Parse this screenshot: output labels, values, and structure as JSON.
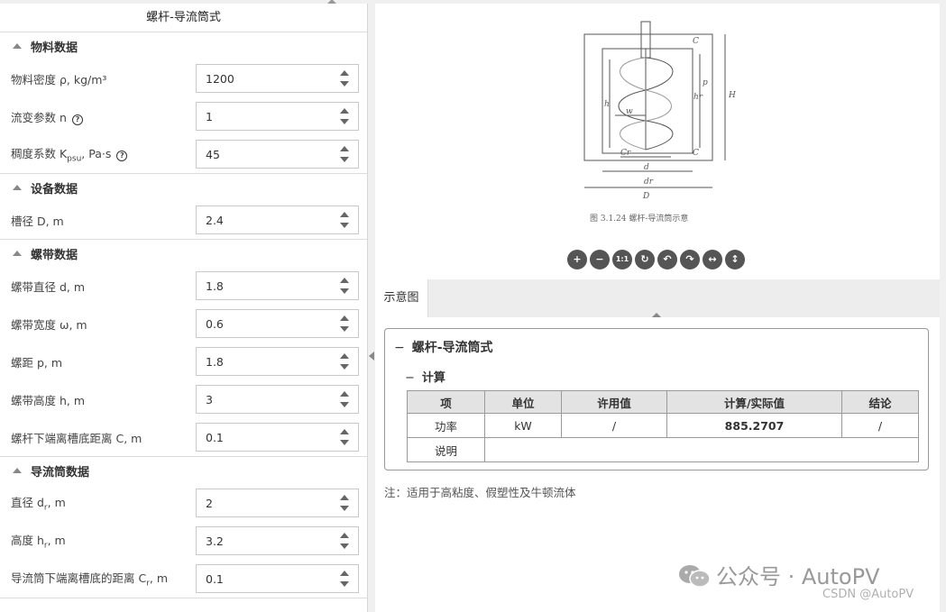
{
  "left": {
    "title": "螺杆-导流筒式",
    "sections": {
      "material": {
        "title": "物料数据",
        "density": {
          "label": "物料密度 ρ, kg/m³",
          "value": "1200"
        },
        "flow_index": {
          "label": "流变参数 n",
          "value": "1"
        },
        "consistency": {
          "label_pre": "稠度系数 K",
          "label_sub": "psu",
          "label_post": ", Pa·s",
          "value": "45"
        }
      },
      "equipment": {
        "title": "设备数据",
        "tank_diameter": {
          "label": "槽径 D, m",
          "value": "2.4"
        }
      },
      "ribbon": {
        "title": "螺带数据",
        "diameter": {
          "label": "螺带直径 d, m",
          "value": "1.8"
        },
        "width": {
          "label": "螺带宽度 ω, m",
          "value": "0.6"
        },
        "pitch": {
          "label": "螺距 p, m",
          "value": "1.8"
        },
        "height": {
          "label": "螺带高度 h, m",
          "value": "3"
        },
        "clearance": {
          "label": "螺杆下端离槽底距离 C, m",
          "value": "0.1"
        }
      },
      "draft_tube": {
        "title": "导流筒数据",
        "diameter": {
          "label_pre": "直径 d",
          "label_sub": "r",
          "label_post": ", m",
          "value": "2"
        },
        "height": {
          "label_pre": "高度 h",
          "label_sub": "r",
          "label_post": ", m",
          "value": "3.2"
        },
        "clearance": {
          "label_pre": "导流筒下端离槽底的距离 C",
          "label_sub": "r",
          "label_post": ", m",
          "value": "0.1"
        }
      }
    }
  },
  "diagram": {
    "caption": "图 3.1.24   螺杆-导流筒示意",
    "labels": {
      "C": "C",
      "p": "p",
      "hr": "hr",
      "H": "H",
      "h": "h",
      "w": "w",
      "Cr": "Cr",
      "d": "d",
      "dr": "dr",
      "D": "D",
      "C2": "C"
    },
    "toolbar": [
      "+",
      "−",
      "1:1",
      "↻",
      "↶",
      "↷",
      "↔",
      "↕"
    ]
  },
  "tabs": [
    {
      "label": "示意图"
    }
  ],
  "results": {
    "title": "螺杆-导流筒式",
    "subtitle": "计算",
    "headers": [
      "项",
      "单位",
      "许用值",
      "计算/实际值",
      "结论"
    ],
    "rows": [
      {
        "item": "功率",
        "unit": "kW",
        "allowed": "/",
        "actual": "885.2707",
        "conclusion": "/"
      }
    ],
    "note_label": "说明",
    "note_value": ""
  },
  "footnote": "注：适用于高粘度、假塑性及牛顿流体",
  "watermark": {
    "main": "公众号 · AutoPV",
    "sub": "CSDN @AutoPV"
  }
}
